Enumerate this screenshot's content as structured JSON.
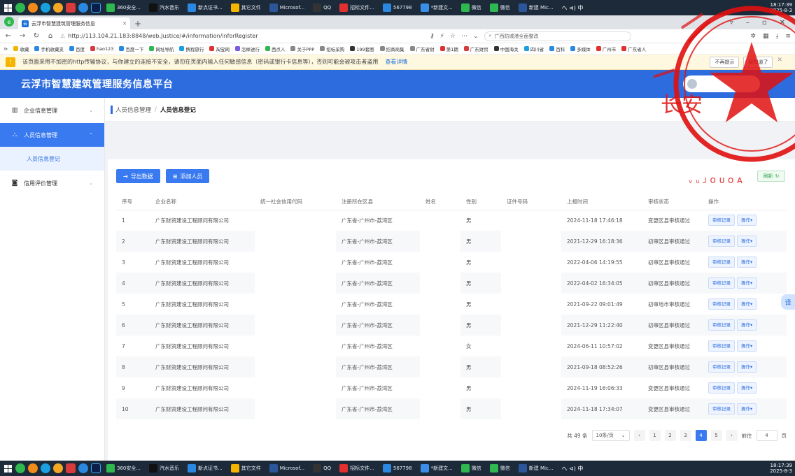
{
  "taskbar": {
    "apps": [
      {
        "label": "360安全...",
        "color": "#2fb84f"
      },
      {
        "label": "汽水音乐",
        "color": "#111111"
      },
      {
        "label": "新点证书...",
        "color": "#2a88e0"
      },
      {
        "label": "其它文件",
        "color": "#f5b400"
      },
      {
        "label": "Microsof...",
        "color": "#2b579a"
      },
      {
        "label": "QQ",
        "color": "#333333"
      },
      {
        "label": "招标文件...",
        "color": "#e03030"
      },
      {
        "label": "567798",
        "color": "#2a88e0"
      },
      {
        "label": "*新建文...",
        "color": "#3a8ee6"
      },
      {
        "label": "微信",
        "color": "#2fb84f"
      },
      {
        "label": "微信",
        "color": "#2fb84f"
      },
      {
        "label": "新建 Mic...",
        "color": "#2b579a"
      }
    ],
    "tray": "へ ⊲) 中",
    "clock_time": "18:17:39",
    "clock_date": "2025-8-3"
  },
  "browser": {
    "tab_title": "云浮市智慧建筑管理服务信息",
    "url": "http://113.104.21.183:8848/web.Justice/#/information/inforRegister",
    "search_placeholder": "广西防城港全面整改",
    "warning": "该页面采用不加密的http传输协议，与你建立的连接不安全，请勿在页面内输入任何敏感信息（密码或银行卡信息等），否则可能会被攻击者盗用",
    "warning_link": "查看详情",
    "warning_btn1": "不再提示",
    "warning_btn2": "我知道了",
    "bookmarks": [
      "收藏",
      "手机收藏夹",
      "百度",
      "hao123",
      "百度一下",
      "网址导航",
      "携程旅行",
      "淘宝网",
      "怎样进行",
      "西点人",
      "关于PPP",
      "招标采购",
      "199套图",
      "招商局集",
      "广东省财",
      "第1期",
      "广东财贸",
      "中国海关",
      "四川省",
      "百科",
      "多媒体",
      "广州市",
      "广东省人"
    ]
  },
  "app": {
    "title": "云浮市智慧建筑管理服务信息平台"
  },
  "sidebar": {
    "items": [
      {
        "label": "企业信息管理"
      },
      {
        "label": "人员信息管理"
      },
      {
        "label": "人员信息登记"
      },
      {
        "label": "信用评价管理"
      }
    ]
  },
  "breadcrumb": {
    "parent": "人员信息管理",
    "current": "人员信息登记"
  },
  "toolbar": {
    "export_label": "导出数据",
    "add_label": "添加人员",
    "refresh_label": "刷新"
  },
  "table": {
    "headers": [
      "序号",
      "企业名称",
      "统一社会信用代码",
      "注册所在区县",
      "姓名",
      "性别",
      "证件号码",
      "上报时间",
      "审核状态",
      "操作"
    ],
    "rows": [
      {
        "no": "1",
        "company": "广东财贸建设工程顾问有限公司",
        "region": "广东省-广州市-荔湾区",
        "gender": "男",
        "time": "2024-11-18 17:46:18",
        "status": "变更区县审核通过"
      },
      {
        "no": "2",
        "company": "广东财贸建设工程顾问有限公司",
        "region": "广东省-广州市-荔湾区",
        "gender": "男",
        "time": "2021-12-29 16:18:36",
        "status": "初审区县审核通过"
      },
      {
        "no": "3",
        "company": "广东财贸建设工程顾问有限公司",
        "region": "广东省-广州市-荔湾区",
        "gender": "男",
        "time": "2022-04-06 14:19:55",
        "status": "初审区县审核通过"
      },
      {
        "no": "4",
        "company": "广东财贸建设工程顾问有限公司",
        "region": "广东省-广州市-荔湾区",
        "gender": "男",
        "time": "2022-04-02 16:34:05",
        "status": "初审区县审核通过"
      },
      {
        "no": "5",
        "company": "广东财贸建设工程顾问有限公司",
        "region": "广东省-广州市-荔湾区",
        "gender": "男",
        "time": "2021-09-22 09:01:49",
        "status": "初审地市审核通过"
      },
      {
        "no": "6",
        "company": "广东财贸建设工程顾问有限公司",
        "region": "广东省-广州市-荔湾区",
        "gender": "男",
        "time": "2021-12-29 11:22:40",
        "status": "初审区县审核通过"
      },
      {
        "no": "7",
        "company": "广东财贸建设工程顾问有限公司",
        "region": "广东省-广州市-荔湾区",
        "gender": "女",
        "time": "2024-06-11 10:57:02",
        "status": "变更区县审核通过"
      },
      {
        "no": "8",
        "company": "广东财贸建设工程顾问有限公司",
        "region": "广东省-广州市-荔湾区",
        "gender": "男",
        "time": "2021-09-18 08:52:26",
        "status": "初审区县审核通过"
      },
      {
        "no": "9",
        "company": "广东财贸建设工程顾问有限公司",
        "region": "广东省-广州市-荔湾区",
        "gender": "男",
        "time": "2024-11-19 16:06:33",
        "status": "变更区县审核通过"
      },
      {
        "no": "10",
        "company": "广东财贸建设工程顾问有限公司",
        "region": "广东省-广州市-荔湾区",
        "gender": "男",
        "time": "2024-11-18 17:34:07",
        "status": "变更区县审核通过"
      }
    ],
    "audit_btn": "审核记录",
    "action_btn": "操作▾"
  },
  "pagination": {
    "total": "共 49 条",
    "page_size": "10条/页",
    "pages": [
      "1",
      "2",
      "3",
      "4",
      "5"
    ],
    "current_page": "4",
    "goto_label": "前往",
    "goto_value": "4",
    "page_suffix": "页"
  },
  "stamp": {
    "text": "长安"
  },
  "colors": {
    "header": "#2d6cdf",
    "accent": "#3a7af0",
    "stamp": "#e01010"
  }
}
